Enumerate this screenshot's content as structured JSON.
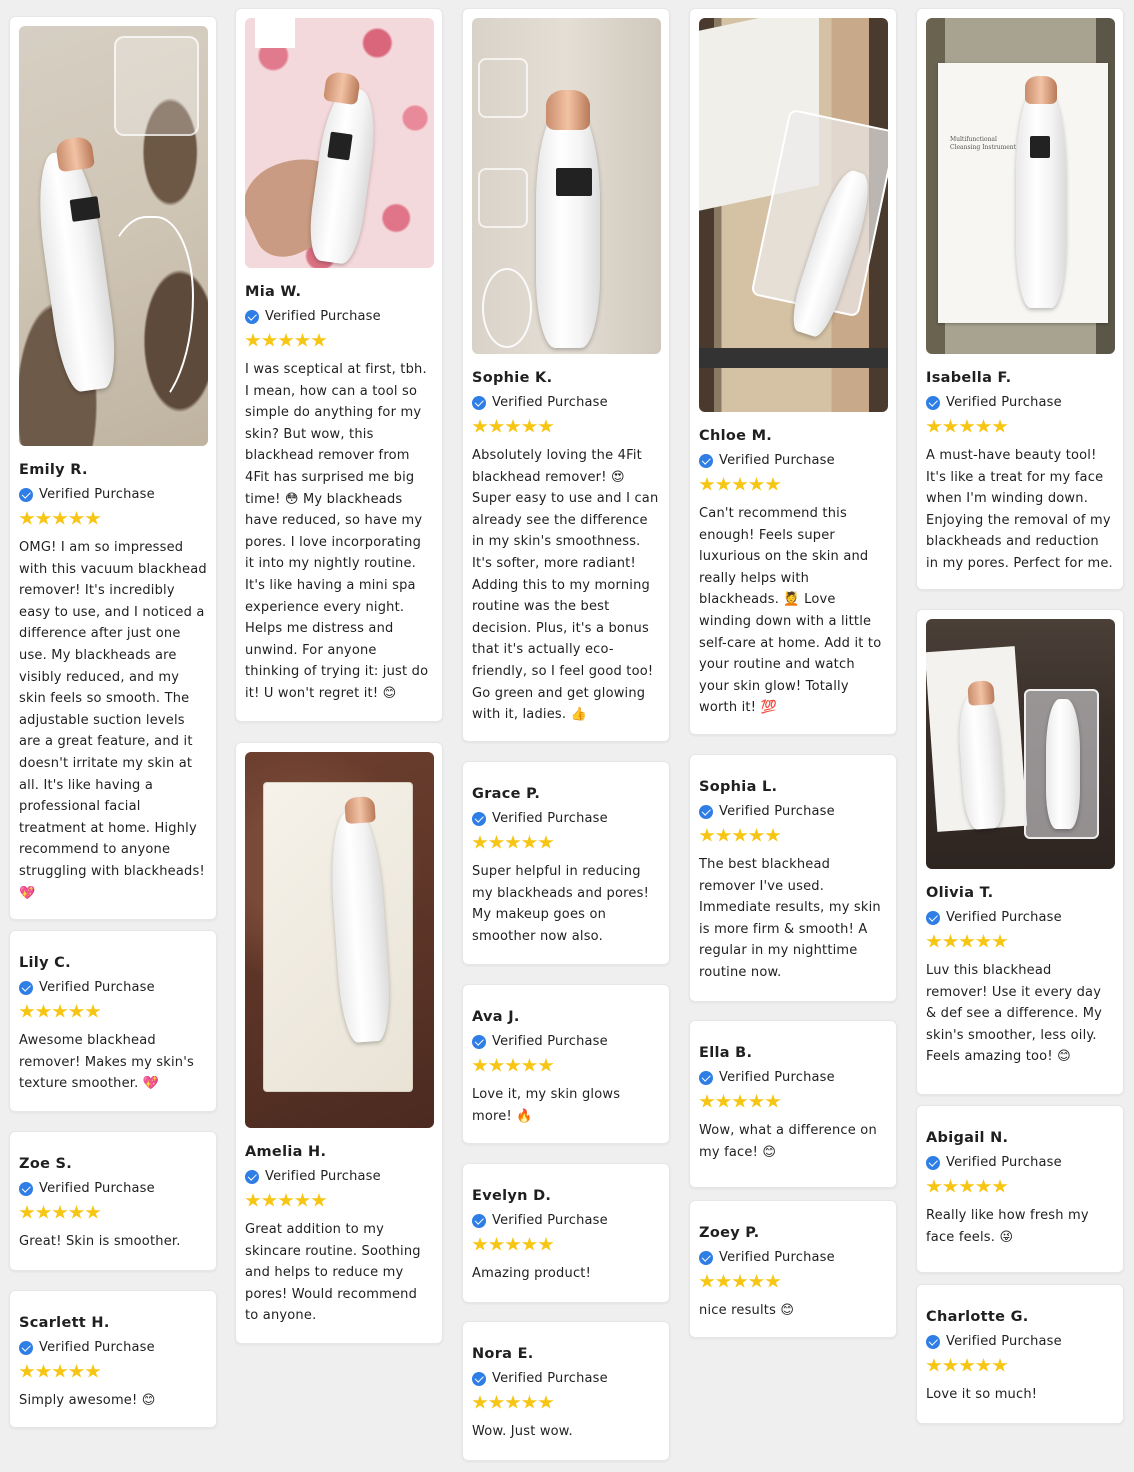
{
  "verified_label": "Verified Purchase",
  "rating_color": "#f7c513",
  "verified_color": "#2f7ee5",
  "columns": [
    [
      {
        "name": "Emily R.",
        "rating": 5,
        "text": "OMG! I am so impressed with this vacuum blackhead remover! It's incredibly easy to use, and I noticed a difference after just one use. My blackheads are visibly reduced, and my skin feels so smooth. The adjustable suction levels are a great feature, and it doesn't irritate my skin at all. It's like having a professional facial treatment at home. Highly recommend to anyone struggling with blackheads! 💖"
      },
      {
        "name": "Lily C.",
        "rating": 5,
        "text": "Awesome blackhead remover! Makes my skin's texture smoother. 💖"
      },
      {
        "name": "Zoe S.",
        "rating": 5,
        "text": "Great! Skin is smoother."
      },
      {
        "name": "Scarlett H.",
        "rating": 5,
        "text": "Simply awesome! 😊"
      }
    ],
    [
      {
        "name": "Mia W.",
        "rating": 5,
        "text": "I was sceptical at first, tbh. I mean, how can a tool so simple do anything for my skin? But wow, this blackhead remover from 4Fit has surprised me big time! 😳 My blackheads have reduced, so have my pores. I love incorporating it into my nightly routine. It's like having a mini spa experience every night. Helps me distress and unwind. For anyone thinking of trying it: just do it! U won't regret it! 😊"
      },
      {
        "name": "Amelia H.",
        "rating": 5,
        "text": "Great addition to my skincare routine. Soothing and helps to reduce my pores! Would recommend to anyone."
      }
    ],
    [
      {
        "name": "Sophie K.",
        "rating": 5,
        "text": "Absolutely loving the 4Fit blackhead remover! 😍 Super easy to use and I can already see the difference in my skin's smoothness. It's softer, more radiant! Adding this to my morning routine was the best decision. Plus, it's a bonus that it's actually eco-friendly, so I feel good too! Go green and get glowing with it, ladies. 👍"
      },
      {
        "name": "Grace P.",
        "rating": 5,
        "text": "Super helpful in reducing my blackheads and pores! My makeup goes on smoother now also."
      },
      {
        "name": "Ava J.",
        "rating": 5,
        "text": "Love it, my skin glows more! 🔥"
      },
      {
        "name": "Evelyn D.",
        "rating": 5,
        "text": "Amazing product!"
      },
      {
        "name": "Nora E.",
        "rating": 5,
        "text": "Wow. Just wow."
      }
    ],
    [
      {
        "name": "Chloe M.",
        "rating": 5,
        "text": "Can't recommend this enough! Feels super luxurious on the skin and really helps with blackheads. 💆 Love winding down with a little self-care at home. Add it to your routine and watch your skin glow! Totally worth it! 💯"
      },
      {
        "name": "Sophia L.",
        "rating": 5,
        "text": "The best blackhead remover I've used. Immediate results, my skin is more firm & smooth! A regular in my nighttime routine now."
      },
      {
        "name": "Ella B.",
        "rating": 5,
        "text": "Wow, what a difference on my face! 😊"
      },
      {
        "name": "Zoey P.",
        "rating": 5,
        "text": "nice results 😊"
      }
    ],
    [
      {
        "name": "Isabella F.",
        "rating": 5,
        "text": "A must-have beauty tool! It's like a treat for my face when I'm winding down. Enjoying the removal of my blackheads and reduction in my pores. Perfect for me."
      },
      {
        "name": "Olivia T.",
        "rating": 5,
        "text": "Luv this blackhead remover! Use it every day & def see a difference. My skin's smoother, less oily. Feels amazing too! 😊"
      },
      {
        "name": "Abigail N.",
        "rating": 5,
        "text": "Really like how fresh my face feels. 😜"
      },
      {
        "name": "Charlotte G.",
        "rating": 5,
        "text": "Love it so much!"
      }
    ]
  ],
  "box_text": "Multifunctional Cleansing Instrument"
}
